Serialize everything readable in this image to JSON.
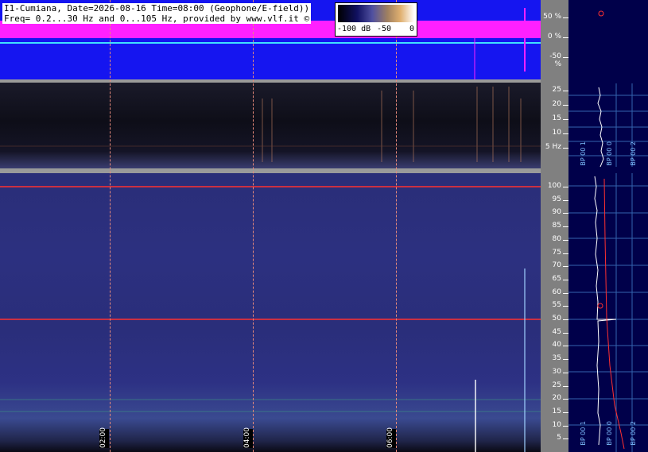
{
  "header": {
    "title_line": "I1-Cumiana, Date=2026-08-16 Time=08:00 (Geophone/E-field))",
    "freq_line": "Freq= 0.2...30 Hz and 0...105 Hz, provided by www.vlf.it ©"
  },
  "colorbar": {
    "labels": [
      "-100 dB",
      "-50",
      "0"
    ]
  },
  "chart_data": [
    {
      "type": "line",
      "panel": "amplitude",
      "y_ticks": [
        "50 %",
        "0 %",
        "-50 %"
      ],
      "ylim": [
        -75,
        75
      ],
      "colors": {
        "trace": "#ff20ff",
        "zero_line": "#40e0ff",
        "background": "#1515f0"
      }
    },
    {
      "type": "heatmap",
      "panel": "spectrogram-low",
      "ylabel": "Hz",
      "y_ticks": [
        "25",
        "20",
        "15",
        "10",
        "5 Hz"
      ],
      "ylim": [
        0,
        30
      ]
    },
    {
      "type": "heatmap",
      "panel": "spectrogram-high",
      "y_ticks": [
        "100",
        "95",
        "90",
        "85",
        "80",
        "75",
        "70",
        "65",
        "60",
        "55",
        "50",
        "45",
        "40",
        "35",
        "30",
        "25",
        "20",
        "15",
        "10",
        "5"
      ],
      "ylim": [
        0,
        105
      ],
      "x_ticks": [
        "02:00",
        "04:00",
        "06:00"
      ],
      "markers_hz": [
        50,
        100
      ],
      "colors": {
        "marker": "#ff3030"
      }
    },
    {
      "type": "line",
      "panel": "spectrum-profile",
      "bp_labels_top": [
        "BP 00 1",
        "BP 00 0",
        "BP 00 2"
      ],
      "bp_labels_bottom": [
        "BP 00 1",
        "BP 00 0",
        "BP 00 2"
      ]
    }
  ]
}
